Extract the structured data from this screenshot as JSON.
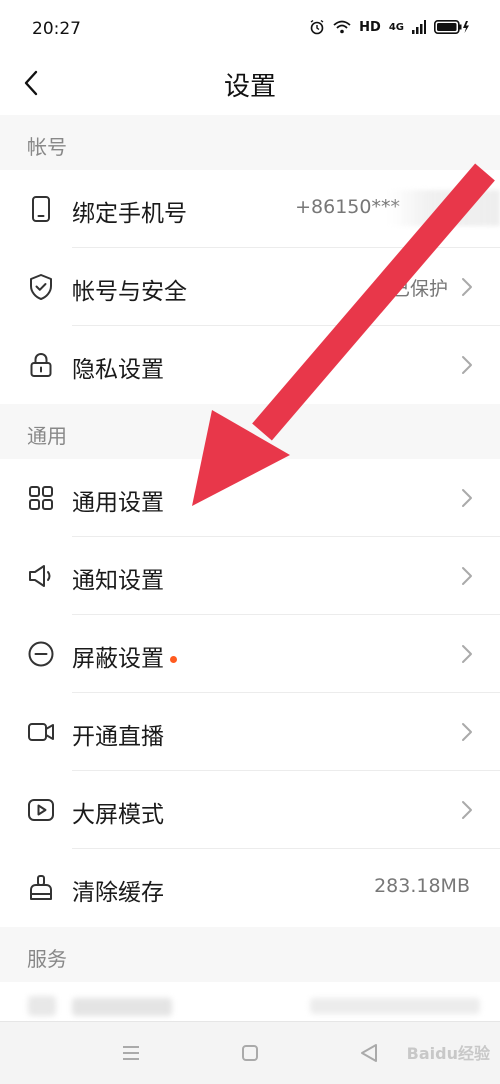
{
  "status_bar": {
    "time": "20:27",
    "hd": "HD",
    "signal": "4G"
  },
  "nav": {
    "title": "设置"
  },
  "sections": {
    "account": {
      "header": "帐号",
      "items": [
        {
          "label": "绑定手机号",
          "value": "+86150***"
        },
        {
          "label": "帐号与安全",
          "value": "已保护"
        },
        {
          "label": "隐私设置"
        }
      ]
    },
    "general": {
      "header": "通用",
      "items": [
        {
          "label": "通用设置"
        },
        {
          "label": "通知设置"
        },
        {
          "label": "屏蔽设置"
        },
        {
          "label": "开通直播"
        },
        {
          "label": "大屏模式"
        },
        {
          "label": "清除缓存",
          "value": "283.18MB"
        }
      ]
    },
    "service": {
      "header": "服务"
    }
  },
  "watermark": "Baidu经验",
  "colors": {
    "accent_dot": "#ff5b1f",
    "arrow": "#e8374a"
  }
}
